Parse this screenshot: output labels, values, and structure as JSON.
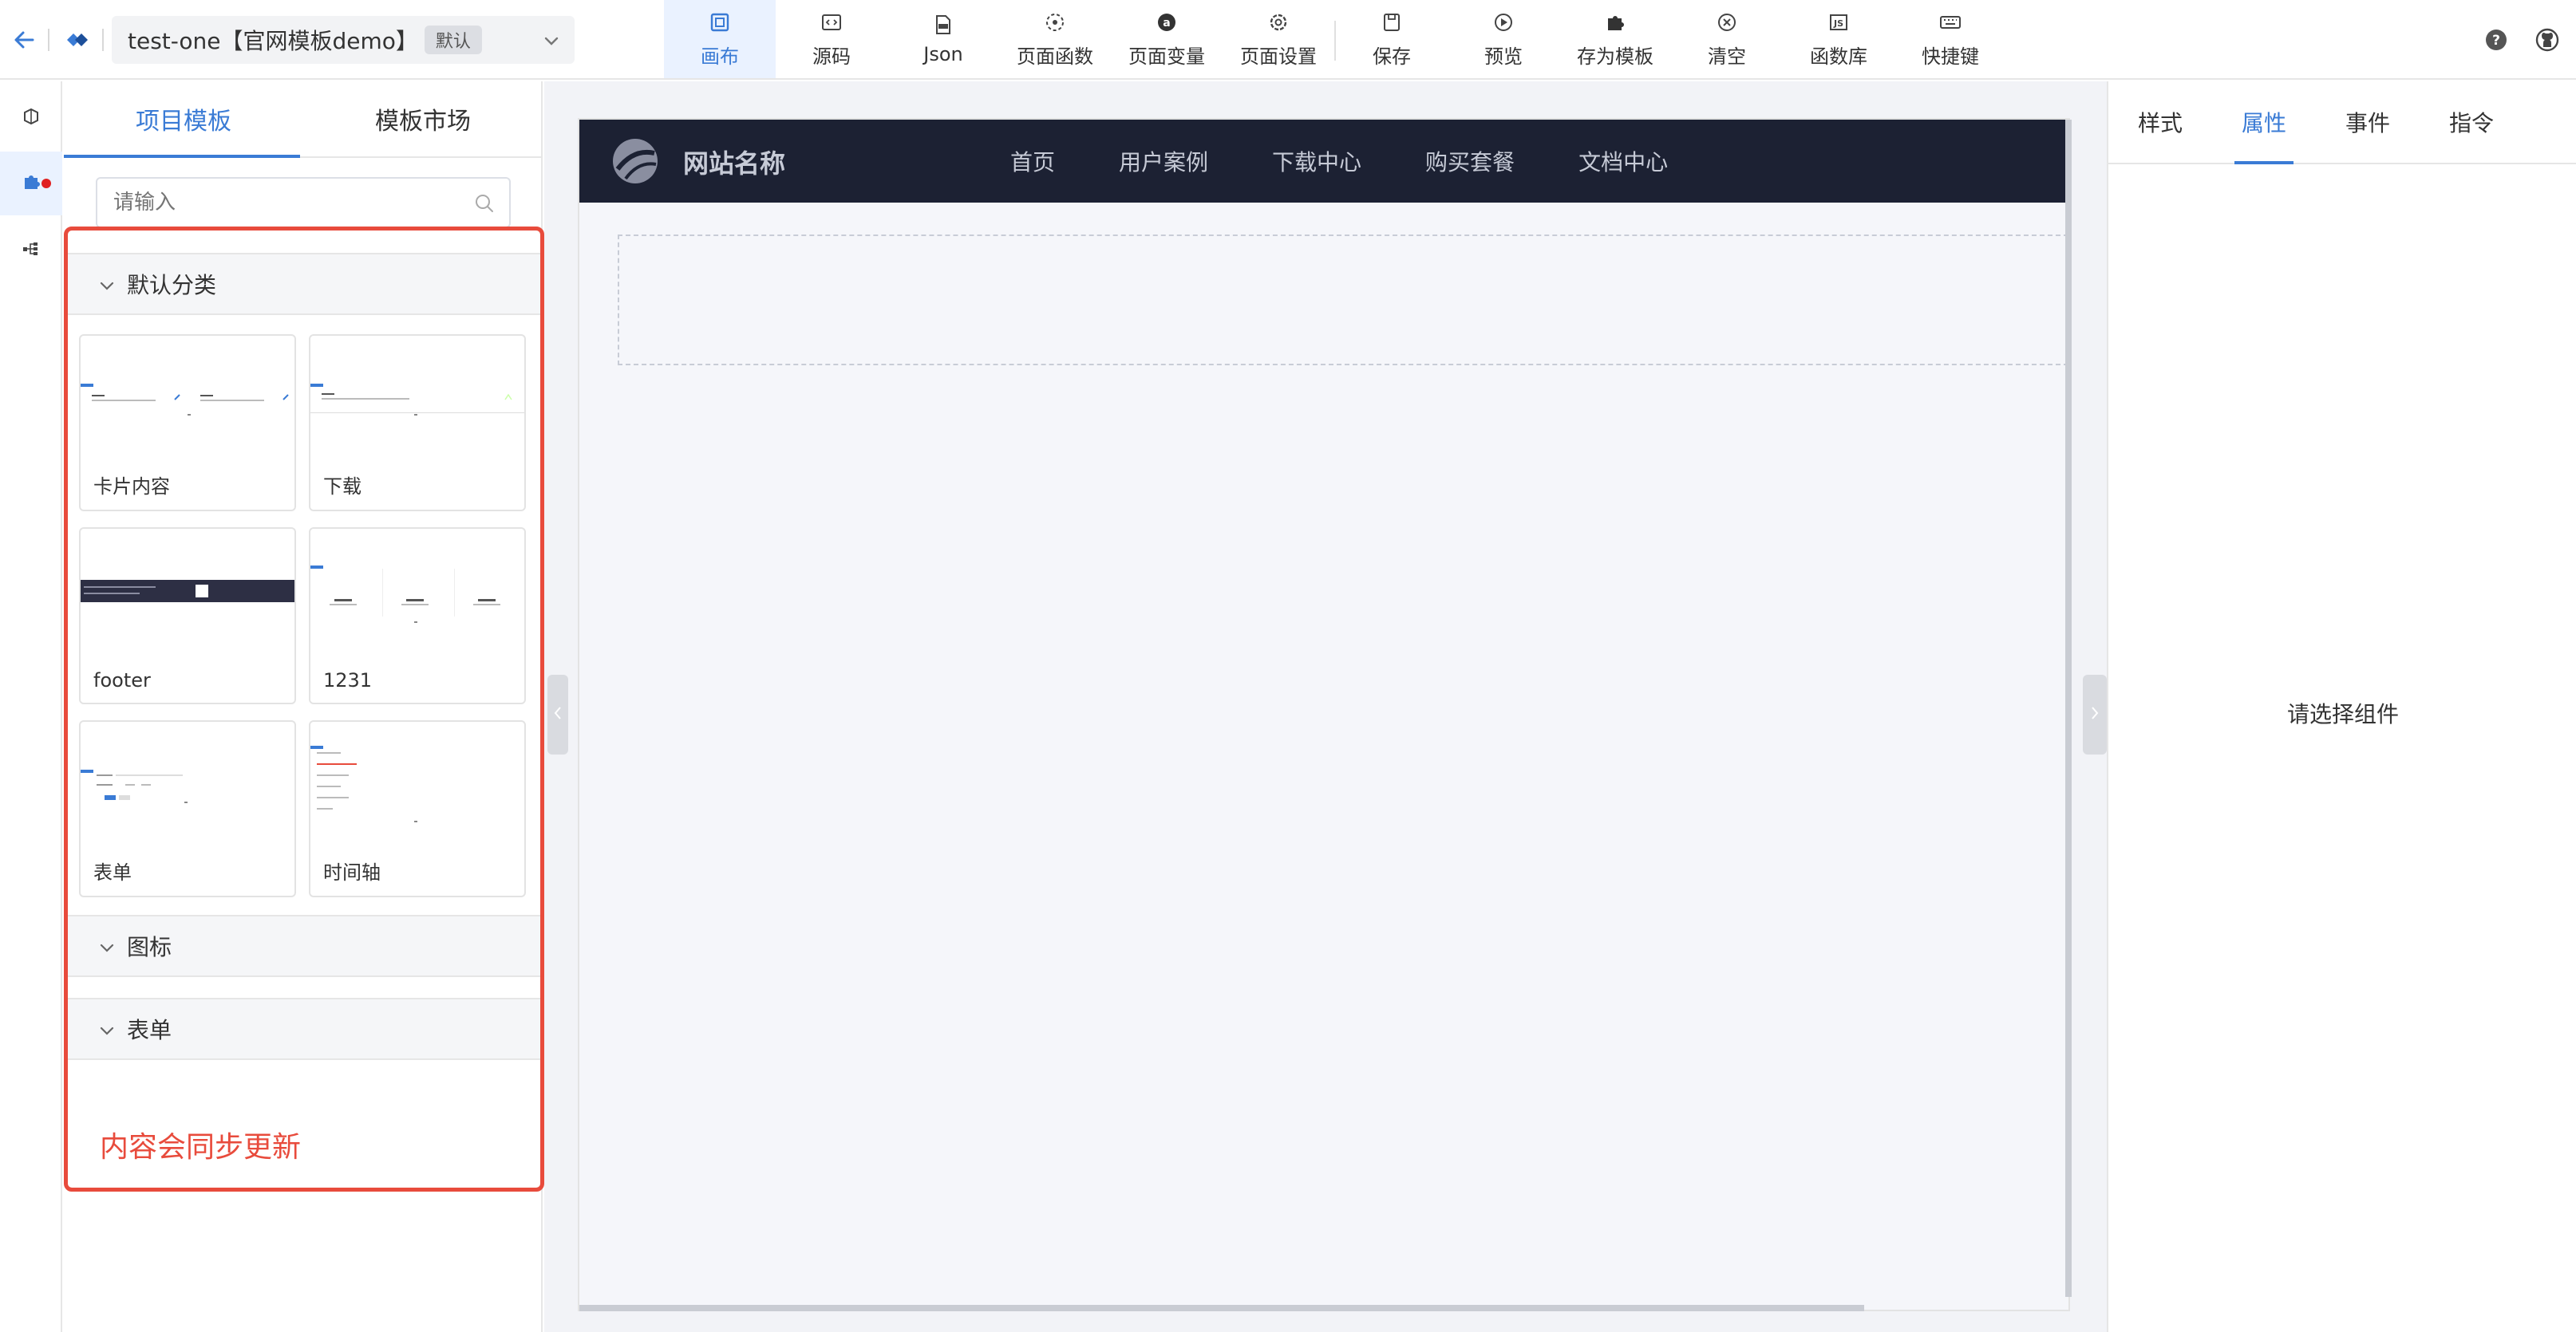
{
  "header": {
    "project_name": "test-one【官网模板demo】",
    "project_badge": "默认",
    "toolbar": [
      {
        "label": "画布",
        "icon": "canvas-icon",
        "active": true
      },
      {
        "label": "源码",
        "icon": "source-code-icon",
        "active": false
      },
      {
        "label": "Json",
        "icon": "json-file-icon",
        "active": false
      },
      {
        "label": "页面函数",
        "icon": "function-icon",
        "active": false
      },
      {
        "label": "页面变量",
        "icon": "variable-icon",
        "active": false
      },
      {
        "label": "页面设置",
        "icon": "settings-icon",
        "active": false
      },
      {
        "label": "保存",
        "icon": "save-icon",
        "active": false
      },
      {
        "label": "预览",
        "icon": "play-icon",
        "active": false
      },
      {
        "label": "存为模板",
        "icon": "puzzle-icon",
        "active": false
      },
      {
        "label": "清空",
        "icon": "clear-icon",
        "active": false
      },
      {
        "label": "函数库",
        "icon": "js-library-icon",
        "active": false
      },
      {
        "label": "快捷键",
        "icon": "keyboard-icon",
        "active": false
      }
    ]
  },
  "left_panel": {
    "tabs": [
      "项目模板",
      "模板市场"
    ],
    "active_tab": 0,
    "search_placeholder": "请输入",
    "categories": [
      {
        "name": "默认分类",
        "expanded": true,
        "templates": [
          "卡片内容",
          "下载",
          "footer",
          "1231",
          "表单",
          "时间轴"
        ]
      },
      {
        "name": "图标",
        "expanded": false
      },
      {
        "name": "表单",
        "expanded": false
      }
    ],
    "sync_note": "内容会同步更新"
  },
  "canvas": {
    "site_name": "网站名称",
    "menu": [
      "首页",
      "用户案例",
      "下载中心",
      "购买套餐",
      "文档中心"
    ]
  },
  "right_panel": {
    "tabs": [
      "样式",
      "属性",
      "事件",
      "指令"
    ],
    "active_tab": 1,
    "placeholder": "请选择组件"
  },
  "colors": {
    "accent": "#3a7bd5",
    "highlight_border": "#e84b3c",
    "nav_bg": "#1c2133",
    "status_dot": "#e02020"
  }
}
